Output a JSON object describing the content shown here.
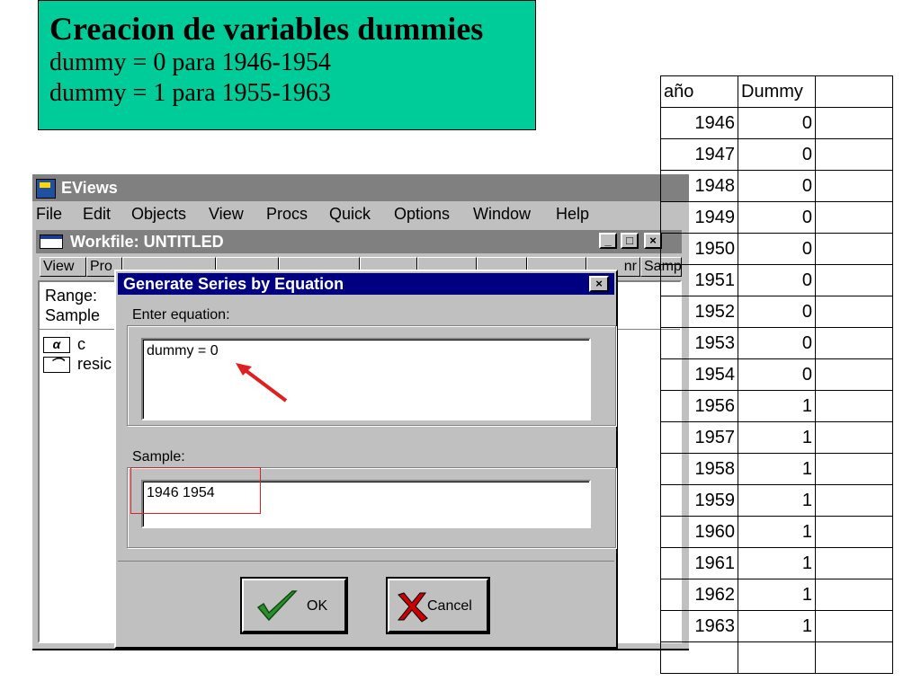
{
  "title_box": {
    "heading": "Creacion de variables dummies",
    "line1": "dummy = 0  para 1946-1954",
    "line2": "dummy = 1  para 1955-1963",
    "bg_color": "#00cc99"
  },
  "eviews": {
    "app_title": "EViews",
    "menu": [
      "File",
      "Edit",
      "Objects",
      "View",
      "Procs",
      "Quick",
      "Options",
      "Window",
      "Help"
    ],
    "workfile": {
      "title": "Workfile: UNTITLED",
      "toolbar": [
        "View",
        "Pro",
        "",
        "",
        "",
        "",
        "",
        "",
        "",
        "nr",
        "Samp"
      ],
      "range_label": "Range:",
      "sample_label": "Sample",
      "objects": [
        {
          "icon": "coef-icon",
          "glyph": "α",
          "name": "c"
        },
        {
          "icon": "series-icon",
          "glyph": "⌒",
          "name": "resic"
        }
      ],
      "window_buttons": [
        "_",
        "□",
        "×"
      ]
    }
  },
  "dialog": {
    "title": "Generate Series by Equation",
    "close_glyph": "×",
    "equation_label": "Enter equation:",
    "equation_value": "dummy = 0",
    "sample_label": "Sample:",
    "sample_value": "1946 1954",
    "ok_label": "OK",
    "cancel_label": "Cancel"
  },
  "table": {
    "headers": [
      "año",
      "Dummy",
      ""
    ],
    "rows": [
      [
        "1946",
        "0"
      ],
      [
        "1947",
        "0"
      ],
      [
        "1948",
        "0"
      ],
      [
        "1949",
        "0"
      ],
      [
        "1950",
        "0"
      ],
      [
        "1951",
        "0"
      ],
      [
        "1952",
        "0"
      ],
      [
        "1953",
        "0"
      ],
      [
        "1954",
        "0"
      ],
      [
        "1956",
        "1"
      ],
      [
        "1957",
        "1"
      ],
      [
        "1958",
        "1"
      ],
      [
        "1959",
        "1"
      ],
      [
        "1960",
        "1"
      ],
      [
        "1961",
        "1"
      ],
      [
        "1962",
        "1"
      ],
      [
        "1963",
        "1"
      ],
      [
        "",
        ""
      ]
    ]
  },
  "colors": {
    "titlebar_active": "#000080",
    "titlebar_inactive": "#808080",
    "face": "#c0c0c0",
    "annotation_red": "#e02020",
    "ok_check": "#2e8b2e",
    "cancel_x": "#cc0000"
  }
}
